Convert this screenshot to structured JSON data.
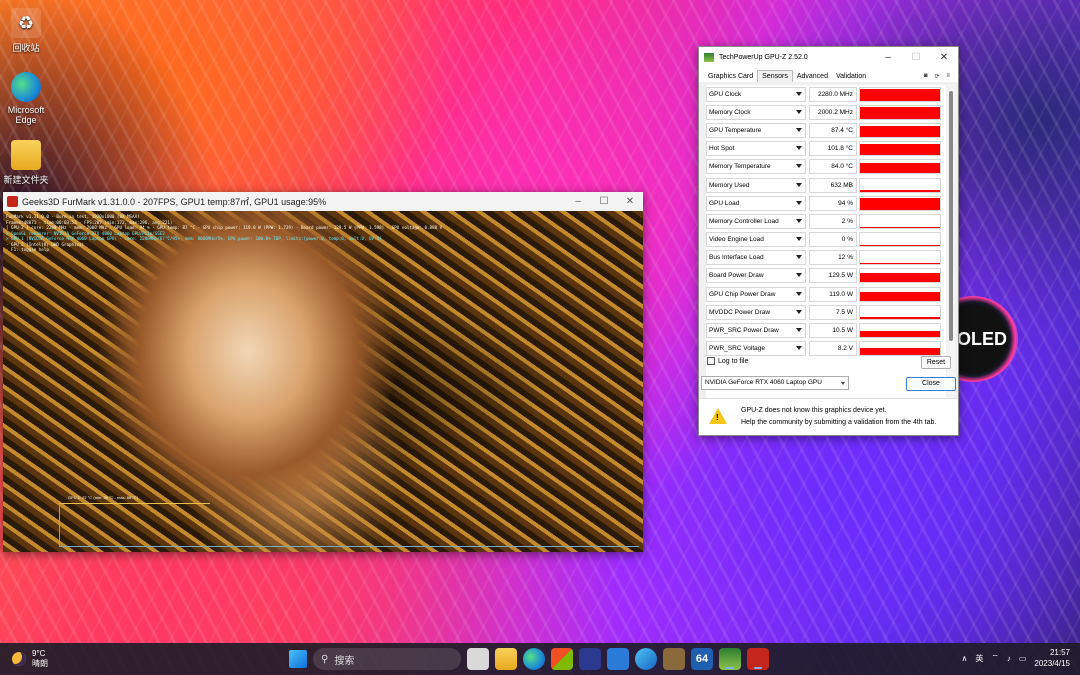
{
  "desktop": {
    "icons": [
      {
        "label": "回收站",
        "icon": "recycle-bin-icon"
      },
      {
        "label": "Microsoft Edge",
        "icon": "edge-icon"
      },
      {
        "label": "新建文件夹",
        "icon": "folder-icon"
      }
    ],
    "badge": "OLED"
  },
  "furmark": {
    "title": "Geeks3D FurMark v1.31.0.0 - 207FPS, GPU1 temp:87㎡, GPU1 usage:95%",
    "hud_lines": [
      "FurMark v1.31.0.0 - Burn-in test, 1920x1080 (0X MSAA)",
      "Frames:48071 - time:00:03:53 - FPS:207 (min:172, max:296, avg:221)",
      "[ GPU-Z ] core: 2280 MHz - mem: 2000 MHz - GPU load: 94 % - GPU temp: 87 °C - GPU chip power: 119.0 W (PPW: 1.739) - Board power: 129.5 W (PPW: 1.598) - GPU voltage: 0.880 V",
      "> OpenGL renderer: NVIDIA GeForce RTX 4060 Laptop GPU/PCIe/SSE2",
      "> GPU 1 (NVIDIA GeForce RTX 4060 Laptop GPU) - core: 2280MHz/87°C/95%, mem: 8000MHz/5%, GPU power: 100.0% TDP, limits:[power:0, temp:0, volt:0, OV:0]",
      "- GPU 2 (Intel(R) UHD Graphics)",
      "- F1: toggle help"
    ],
    "graph_label": "GPU 1: 87 °C (min: 39 °C - max: 88 °C)"
  },
  "gpuz": {
    "title": "TechPowerUp GPU-Z 2.52.0",
    "tabs": [
      "Graphics Card",
      "Sensors",
      "Advanced",
      "Validation"
    ],
    "active_tab": "Sensors",
    "sensor_fill_color": "#ff0000",
    "sensors": [
      {
        "name": "GPU Clock",
        "value": "2280.0 MHz",
        "level": 0.92
      },
      {
        "name": "Memory Clock",
        "value": "2000.2 MHz",
        "level": 0.92
      },
      {
        "name": "GPU Temperature",
        "value": "87.4 °C",
        "level": 0.82
      },
      {
        "name": "Hot Spot",
        "value": "101.8 °C",
        "level": 0.88
      },
      {
        "name": "Memory Temperature",
        "value": "84.0 °C",
        "level": 0.8
      },
      {
        "name": "Memory Used",
        "value": "632 MB",
        "level": 0.1
      },
      {
        "name": "GPU Load",
        "value": "94 %",
        "level": 0.94
      },
      {
        "name": "Memory Controller Load",
        "value": "2 %",
        "level": 0.02
      },
      {
        "name": "Video Engine Load",
        "value": "0 %",
        "level": 0.0
      },
      {
        "name": "Bus Interface Load",
        "value": "12 %",
        "level": 0.12
      },
      {
        "name": "Board Power Draw",
        "value": "129.5 W",
        "level": 0.7
      },
      {
        "name": "GPU Chip Power Draw",
        "value": "119.0 W",
        "level": 0.65
      },
      {
        "name": "MVDDC Power Draw",
        "value": "7.5 W",
        "level": 0.15
      },
      {
        "name": "PWR_SRC Power Draw",
        "value": "10.5 W",
        "level": 0.5
      },
      {
        "name": "PWR_SRC Voltage",
        "value": "8.2 V",
        "level": 0.55
      }
    ],
    "log_to_file": "Log to file",
    "reset": "Reset",
    "device": "NVIDIA GeForce RTX 4060 Laptop GPU",
    "close": "Close",
    "notice_line1": "GPU-Z does not know this graphics device yet.",
    "notice_line2": "Help the community by submitting a validation from the 4th tab."
  },
  "taskbar": {
    "weather_temp": "9°C",
    "weather_desc": "晴朗",
    "search_placeholder": "搜索",
    "apps": [
      "widgets-icon",
      "file-explorer-icon",
      "edge-icon",
      "store-icon",
      "app-icon",
      "app-icon",
      "edge-icon",
      "app-icon",
      "aida64-icon",
      "gpuz-icon",
      "furmark-icon"
    ],
    "aida_label": "64",
    "ime": "英",
    "time": "21:57",
    "date": "2023/4/15"
  }
}
